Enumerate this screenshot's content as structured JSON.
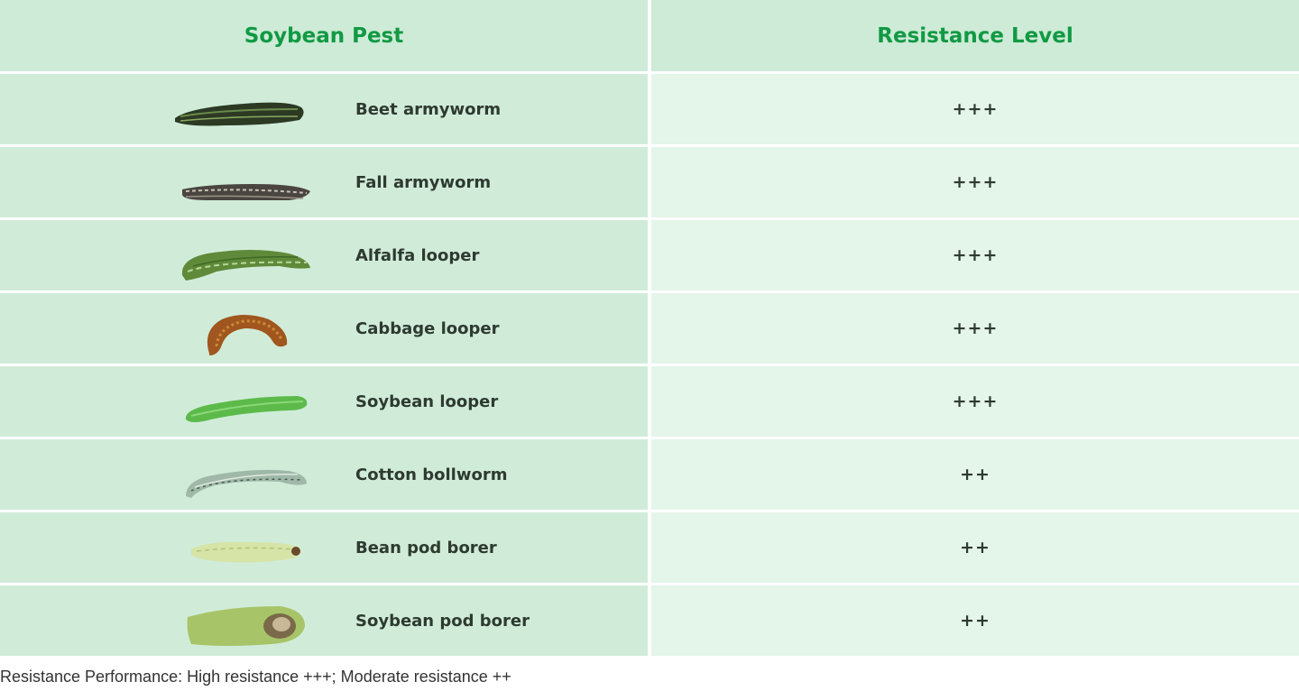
{
  "table": {
    "headers": {
      "pest": "Soybean Pest",
      "level": "Resistance Level"
    },
    "rows": [
      {
        "name": "Beet armyworm",
        "level": "+++",
        "icon": "beet-armyworm-image"
      },
      {
        "name": "Fall armyworm",
        "level": "+++",
        "icon": "fall-armyworm-image"
      },
      {
        "name": "Alfalfa looper",
        "level": "+++",
        "icon": "alfalfa-looper-image"
      },
      {
        "name": "Cabbage looper",
        "level": "+++",
        "icon": "cabbage-looper-image"
      },
      {
        "name": "Soybean looper",
        "level": "+++",
        "icon": "soybean-looper-image"
      },
      {
        "name": "Cotton bollworm",
        "level": "++",
        "icon": "cotton-bollworm-image"
      },
      {
        "name": "Bean pod borer",
        "level": "++",
        "icon": "bean-pod-borer-image"
      },
      {
        "name": "Soybean pod borer",
        "level": "++",
        "icon": "soybean-pod-borer-image"
      }
    ]
  },
  "footer": {
    "note": "Resistance Performance: High resistance +++; Moderate resistance ++"
  },
  "colors": {
    "header_text": "#119944",
    "header_bg": "#cdebd6",
    "pest_cell_bg": "#d0ecd9",
    "level_cell_bg": "#e4f5e9"
  }
}
